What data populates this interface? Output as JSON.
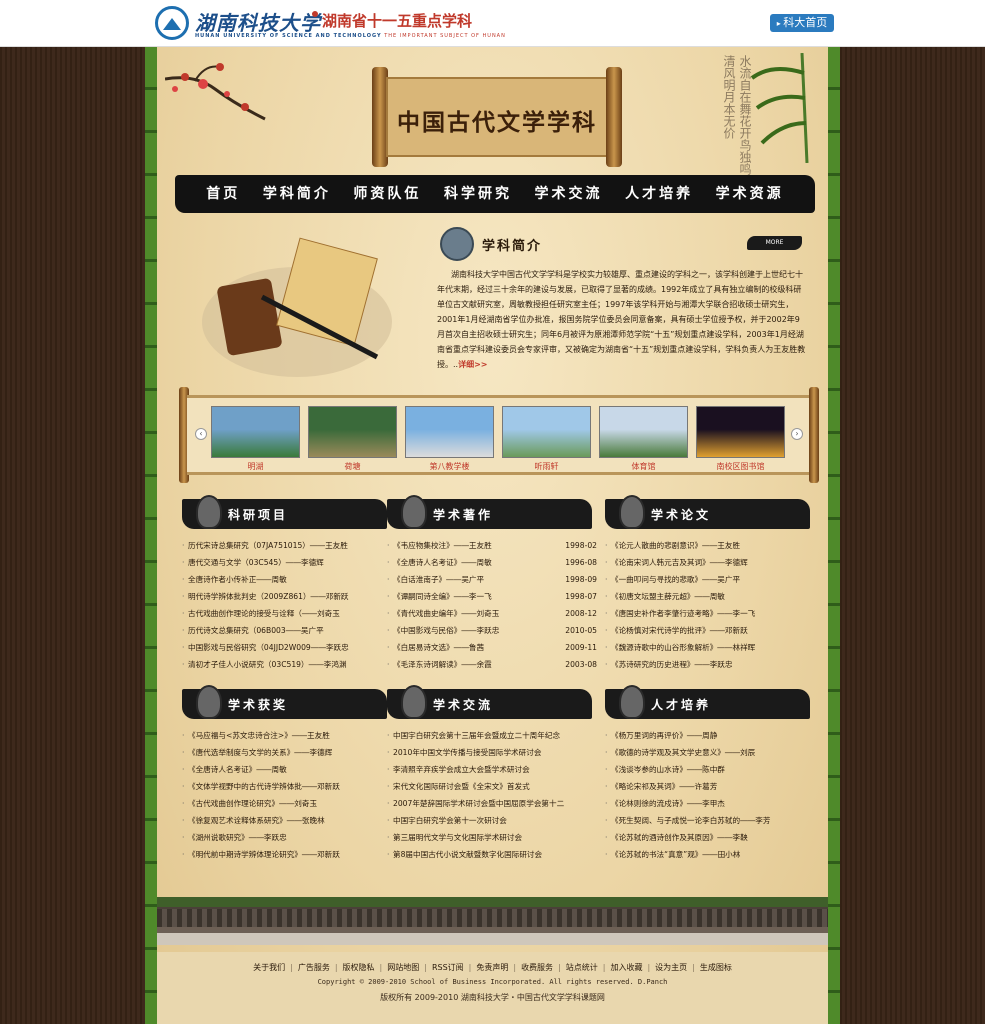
{
  "topbar": {
    "univ_name": "湖南科技大学",
    "discipline": "湖南省十一五重点学科",
    "univ_en": "HUNAN UNIVERSITY OF SCIENCE AND TECHNOLOGY",
    "subject_en": "THE IMPORTANT SUBJECT OF HUNAN",
    "home_link": "科大首页"
  },
  "header": {
    "title": "中国古代文学学科",
    "calligraphy": "水流自在舞花开鸟独鸣清风明月本无价"
  },
  "nav": {
    "items": [
      "首页",
      "学科简介",
      "师资队伍",
      "科学研究",
      "学术交流",
      "人才培养",
      "学术资源"
    ]
  },
  "intro": {
    "title": "学科简介",
    "more": "MORE",
    "text": "湖南科技大学中国古代文学学科是学校实力较雄厚、重点建设的学科之一，该学科创建于上世纪七十年代末期，经过三十余年的建设与发展，已取得了显著的成绩。1992年成立了具有独立编制的校级科研单位古文献研究室，周敏教授担任研究室主任；1997年该学科开始与湘潭大学联合招收硕士研究生，2001年1月经湖南省学位办批准，报国务院学位委员会同意备案，具有硕士学位授予权，并于2002年9月首次自主招收硕士研究生；同年6月被评为原湘潭师范学院“十五”规划重点建设学科，2003年1月经湖南省重点学科建设委员会专家评审，又被确定为湖南省“十五”规划重点建设学科，学科负责人为王友胜教授。..",
    "detail": "详细>>"
  },
  "gallery": {
    "items": [
      {
        "caption": "明湖",
        "colors": [
          "#6fa0c8",
          "#3a7a3a"
        ]
      },
      {
        "caption": "荷塘",
        "colors": [
          "#3a6a3a",
          "#9a8a5a"
        ]
      },
      {
        "caption": "第八教学楼",
        "colors": [
          "#7ab0e0",
          "#dcdcdc"
        ]
      },
      {
        "caption": "听雨轩",
        "colors": [
          "#a0c8e8",
          "#6a9a5a"
        ]
      },
      {
        "caption": "体育馆",
        "colors": [
          "#c8d8e8",
          "#4a7a3a"
        ]
      },
      {
        "caption": "南校区图书馆",
        "colors": [
          "#1a1020",
          "#e0a030"
        ]
      }
    ]
  },
  "sections": {
    "research_projects": {
      "title": "科研项目",
      "items": [
        {
          "text": "历代宋诗总集研究（07JA751015）――王友胜",
          "date": ""
        },
        {
          "text": "唐代交通与文学（03C545）――李德辉",
          "date": ""
        },
        {
          "text": "全唐诗作者小传补正――周敏",
          "date": ""
        },
        {
          "text": "明代诗学辨体批判史（2009Z861）――邓新跃",
          "date": ""
        },
        {
          "text": "古代戏曲创作理论的接受与诠释（――刘奇玉",
          "date": ""
        },
        {
          "text": "历代诗文总集研究（06B003――吴广平",
          "date": ""
        },
        {
          "text": "中国影戏与民俗研究（04JJD2W009――李跃忠",
          "date": ""
        },
        {
          "text": "清初才子佳人小说研究（03C519）――李鸿渊",
          "date": ""
        }
      ]
    },
    "works": {
      "title": "学术著作",
      "items": [
        {
          "text": "《韦应物集校注》――王友胜",
          "date": "1998-02"
        },
        {
          "text": "《全唐诗人名考证》――周敏",
          "date": "1996-08"
        },
        {
          "text": "《白话淮南子》――吴广平",
          "date": "1998-09"
        },
        {
          "text": "《谭嗣同诗全编》――李一飞",
          "date": "1998-07"
        },
        {
          "text": "《青代戏曲史编年》――刘奇玉",
          "date": "2008-12"
        },
        {
          "text": "《中国影戏与民俗》――李跃忠",
          "date": "2010-05"
        },
        {
          "text": "《白居易诗文选》――鲁茜",
          "date": "2009-11"
        },
        {
          "text": "《毛泽东诗词解读》――余霞",
          "date": "2003-08"
        }
      ]
    },
    "papers": {
      "title": "学术论文",
      "items": [
        {
          "text": "《论元人散曲的悲剧意识》――王友胜",
          "date": ""
        },
        {
          "text": "《论南宋词人韩元吉及其词》――李德辉",
          "date": ""
        },
        {
          "text": "《一曲叩问与寻找的悲歌》――吴广平",
          "date": ""
        },
        {
          "text": "《初唐文坛盟主薛元超》――周敏",
          "date": ""
        },
        {
          "text": "《唐国史补作者李肇行迹考略》――李一飞",
          "date": ""
        },
        {
          "text": "《论杨慎对宋代诗学的批评》――邓新跃",
          "date": ""
        },
        {
          "text": "《魏源诗歌中的山谷形象解析》――林祥晖",
          "date": ""
        },
        {
          "text": "《苏诗研究的历史进程》――李跃忠",
          "date": ""
        }
      ]
    },
    "awards": {
      "title": "学术获奖",
      "items": [
        {
          "text": "《马应福与<苏文忠诗合注>》――王友胜",
          "date": ""
        },
        {
          "text": "《唐代选举制度与文学的关系》――李德辉",
          "date": ""
        },
        {
          "text": "《全唐诗人名考证》――周敏",
          "date": ""
        },
        {
          "text": "《文体学视野中的古代诗学辨体批――邓新跃",
          "date": ""
        },
        {
          "text": "《古代戏曲创作理论研究》――刘奇玉",
          "date": ""
        },
        {
          "text": "《徐复观艺术诠释体系研究》――张晚林",
          "date": ""
        },
        {
          "text": "《湖州说歌研究》――李跃忠",
          "date": ""
        },
        {
          "text": "《明代前中期诗学辨体理论研究》――邓新跃",
          "date": ""
        }
      ]
    },
    "exchange": {
      "title": "学术交流",
      "items": [
        {
          "text": "中国宇白研究会第十三届年会暨成立二十周年纪念",
          "date": ""
        },
        {
          "text": "2010年中国文学传播与接受国际学术研讨会",
          "date": ""
        },
        {
          "text": "李清照辛弃疾学会成立大会暨学术研讨会",
          "date": ""
        },
        {
          "text": "宋代文化国际研讨会暨《全宋文》首发式",
          "date": ""
        },
        {
          "text": "2007年楚辞国际学术研讨会暨中国屈原学会第十二",
          "date": ""
        },
        {
          "text": "中国宇白研究学会第十一次研讨会",
          "date": ""
        },
        {
          "text": "第三届明代文学与文化国际学术研讨会",
          "date": ""
        },
        {
          "text": "第8届中国古代小说文献暨数字化国际研讨会",
          "date": ""
        }
      ]
    },
    "talent": {
      "title": "人才培养",
      "items": [
        {
          "text": "《杨万里词的再评价》――周静",
          "date": ""
        },
        {
          "text": "《歌德的诗学观及其文学史意义》――刘辰",
          "date": ""
        },
        {
          "text": "《浅谈岑参的山水诗》――陈中群",
          "date": ""
        },
        {
          "text": "《略论宋祁及其词》――许葛芳",
          "date": ""
        },
        {
          "text": "《论林则徐的流戍诗》――李甲杰",
          "date": ""
        },
        {
          "text": "《死生契阔、与子成悦一论李白苏轼的――李芳",
          "date": ""
        },
        {
          "text": "《论苏轼的酒诗创作及其原因》――李鞅",
          "date": ""
        },
        {
          "text": "《论苏轼的书法“真意”观》――田小林",
          "date": ""
        }
      ]
    }
  },
  "footer": {
    "links": [
      "关于我们",
      "广告服务",
      "版权隐私",
      "网站地图",
      "RSS订阅",
      "免责声明",
      "收费服务",
      "站点统计",
      "加入收藏",
      "设为主页",
      "生成图标"
    ],
    "copyright": "Copyright © 2009-2010 School of Business Incorporated. All rights reserved. D.Panch",
    "rights": "版权所有 2009-2010 湖南科技大学・中国古代文学学科课题网"
  }
}
